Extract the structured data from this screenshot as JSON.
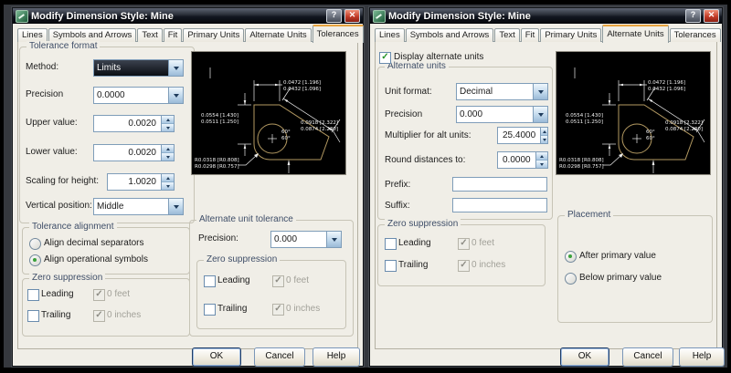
{
  "window": {
    "title": "Modify Dimension Style: Mine",
    "help": "?",
    "close": "✕"
  },
  "tabs": [
    "Lines",
    "Symbols and Arrows",
    "Text",
    "Fit",
    "Primary Units",
    "Alternate Units",
    "Tolerances"
  ],
  "preview": {
    "top1": "0.0472 [1.196]",
    "top2": "0.0432 [1.096]",
    "left1": "0.0554 [1.430]",
    "left2": "0.0511 [1.250]",
    "right1": "0.0918 [2.322]",
    "right2": "0.0874 [2.230]",
    "rad1": "R0.0318 [R0.808]",
    "rad2": "R0.0298 [R0.757]",
    "angle1": "60°",
    "angle2": "60°"
  },
  "left": {
    "active_tab": "Tolerances",
    "tolerance_format": {
      "title": "Tolerance format",
      "method_label": "Method:",
      "method_value": "Limits",
      "precision_label": "Precision",
      "precision_value": "0.0000",
      "upper_label": "Upper value:",
      "upper_value": "0.0020",
      "lower_label": "Lower value:",
      "lower_value": "0.0020",
      "scaling_label": "Scaling for height:",
      "scaling_value": "1.0020",
      "vertical_label": "Vertical position:",
      "vertical_value": "Middle"
    },
    "tolerance_alignment": {
      "title": "Tolerance alignment",
      "decimal": "Align decimal separators",
      "operational": "Align operational symbols"
    },
    "zero_suppression": {
      "title": "Zero suppression",
      "leading": "Leading",
      "trailing": "Trailing",
      "feet": "0 feet",
      "inches": "0 inches"
    },
    "alt_tolerance": {
      "title": "Alternate unit tolerance",
      "precision_label": "Precision:",
      "precision_value": "0.000",
      "zero": {
        "title": "Zero suppression",
        "leading": "Leading",
        "trailing": "Trailing",
        "feet": "0 feet",
        "inches": "0 inches"
      }
    },
    "buttons": {
      "ok": "OK",
      "cancel": "Cancel",
      "help": "Help"
    }
  },
  "right": {
    "active_tab": "Alternate Units",
    "display_alt": "Display alternate units",
    "alternate_units": {
      "title": "Alternate units",
      "unit_format_label": "Unit format:",
      "unit_format_value": "Decimal",
      "precision_label": "Precision",
      "precision_value": "0.000",
      "multiplier_label": "Multiplier for alt units:",
      "multiplier_value": "25.4000",
      "round_label": "Round distances to:",
      "round_value": "0.0000",
      "prefix_label": "Prefix:",
      "suffix_label": "Suffix:"
    },
    "zero_suppression": {
      "title": "Zero suppression",
      "leading": "Leading",
      "trailing": "Trailing",
      "feet": "0 feet",
      "inches": "0 inches"
    },
    "placement": {
      "title": "Placement",
      "after": "After primary value",
      "below": "Below primary value"
    },
    "buttons": {
      "ok": "OK",
      "cancel": "Cancel",
      "help": "Help"
    }
  },
  "colors": {
    "dialog_bg": "#f0eee7",
    "titlebar_dark": "#0a0d14",
    "active_tab_accent": "#e7a33e",
    "preview_shape": "#b49a62",
    "preview_dims": "#ececec",
    "selected_combo_bg": "#11151d",
    "check_green": "#289428",
    "close_red": "#c33c28"
  }
}
